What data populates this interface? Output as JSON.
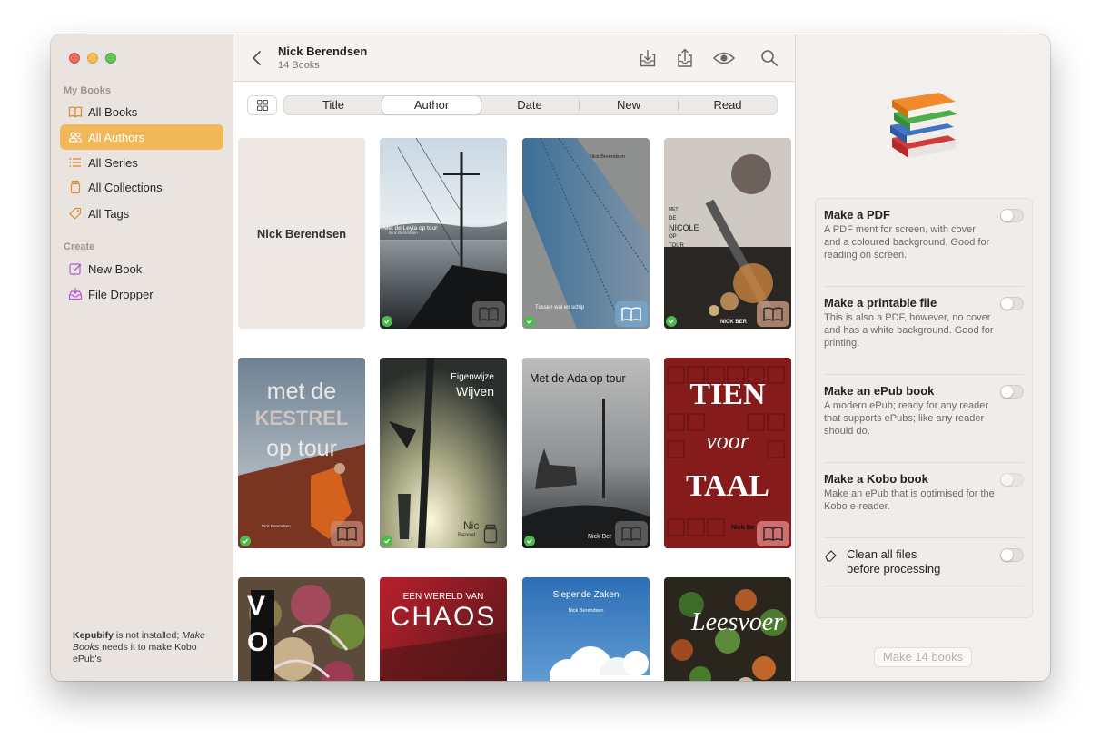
{
  "sidebar": {
    "section_my_books": "My Books",
    "items": [
      {
        "label": "All Books",
        "icon": "book-icon"
      },
      {
        "label": "All Authors",
        "icon": "people-icon",
        "active": true
      },
      {
        "label": "All Series",
        "icon": "list-icon"
      },
      {
        "label": "All Collections",
        "icon": "jar-icon"
      },
      {
        "label": "All Tags",
        "icon": "tag-icon"
      }
    ],
    "section_create": "Create",
    "create_items": [
      {
        "label": "New Book",
        "icon": "compose-icon"
      },
      {
        "label": "File Dropper",
        "icon": "tray-icon"
      }
    ],
    "note_part1": "Kepubify",
    "note_part2": " is not installed; ",
    "note_part3": "Make Books",
    "note_part4": " needs it to make Kobo ePub's"
  },
  "header": {
    "title": "Nick Berendsen",
    "subtitle": "14 Books"
  },
  "sort_tabs": [
    "Title",
    "Author",
    "Date",
    "New",
    "Read"
  ],
  "selected_tab": "Author",
  "books": [
    {
      "cover": "author-placeholder",
      "text": "Nick Berendsen"
    },
    {
      "cover": "ship-sunset",
      "title": "Met de Leyla op tour",
      "author": "Nick Berendsen",
      "done": true
    },
    {
      "cover": "blue-strap",
      "author": "Nick Berendsen",
      "subtitle": "Tussen wal en schip",
      "done": true
    },
    {
      "cover": "turntable",
      "title_lines": [
        "MET",
        "DE",
        "NICOLE",
        "OP",
        "TOUR"
      ],
      "author": "NICK BER",
      "done": true
    },
    {
      "cover": "kestrel",
      "title_lines": [
        "met de",
        "KESTREL",
        "op tour"
      ],
      "author": "Nick Berendsen",
      "done": true
    },
    {
      "cover": "mast",
      "title_lines": [
        "Eigenwijze",
        "Wijven"
      ],
      "author_short": "Nic",
      "author": "Berend",
      "done": true
    },
    {
      "cover": "ada",
      "title": "Met de Ada op tour",
      "author": "Nick Ber",
      "done": true
    },
    {
      "cover": "tien-voor-taal",
      "title_lines": [
        "TIEN",
        "voor",
        "TAAL"
      ],
      "author": "Nick Be",
      "done": false
    },
    {
      "cover": "vo-food",
      "title": "VO"
    },
    {
      "cover": "chaos",
      "title_lines": [
        "EEN WERELD VAN",
        "CHAOS"
      ]
    },
    {
      "cover": "sky",
      "title": "Slepende Zaken",
      "author": "Nick Berendsen"
    },
    {
      "cover": "leesvoer",
      "title": "Leesvoer"
    }
  ],
  "options": [
    {
      "title": "Make a PDF",
      "desc": "A PDF ment for screen, with cover and a coloured background. Good for reading on screen."
    },
    {
      "title": "Make a printable file",
      "desc": "This is also a PDF, however, no cover and has a white background. Good for printing."
    },
    {
      "title": "Make an ePub book",
      "desc": "A modern ePub; ready for any reader that supports ePubs; like any reader should do."
    },
    {
      "title": "Make a Kobo book",
      "desc": "Make an ePub that is optimised for the Kobo e-reader."
    }
  ],
  "clean_option": {
    "line1": "Clean all files",
    "line2": "before processing"
  },
  "make_button": "Make 14 books",
  "colors": {
    "accent": "#f1b85a",
    "check": "#4cbb4c"
  }
}
